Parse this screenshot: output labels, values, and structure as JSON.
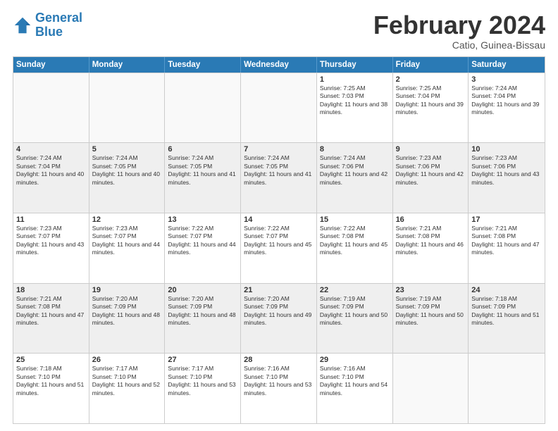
{
  "header": {
    "logo_line1": "General",
    "logo_line2": "Blue",
    "month": "February 2024",
    "location": "Catio, Guinea-Bissau"
  },
  "weekdays": [
    "Sunday",
    "Monday",
    "Tuesday",
    "Wednesday",
    "Thursday",
    "Friday",
    "Saturday"
  ],
  "rows": [
    [
      {
        "day": "",
        "sunrise": "",
        "sunset": "",
        "daylight": "",
        "empty": true
      },
      {
        "day": "",
        "sunrise": "",
        "sunset": "",
        "daylight": "",
        "empty": true
      },
      {
        "day": "",
        "sunrise": "",
        "sunset": "",
        "daylight": "",
        "empty": true
      },
      {
        "day": "",
        "sunrise": "",
        "sunset": "",
        "daylight": "",
        "empty": true
      },
      {
        "day": "1",
        "sunrise": "Sunrise: 7:25 AM",
        "sunset": "Sunset: 7:03 PM",
        "daylight": "Daylight: 11 hours and 38 minutes."
      },
      {
        "day": "2",
        "sunrise": "Sunrise: 7:25 AM",
        "sunset": "Sunset: 7:04 PM",
        "daylight": "Daylight: 11 hours and 39 minutes."
      },
      {
        "day": "3",
        "sunrise": "Sunrise: 7:24 AM",
        "sunset": "Sunset: 7:04 PM",
        "daylight": "Daylight: 11 hours and 39 minutes."
      }
    ],
    [
      {
        "day": "4",
        "sunrise": "Sunrise: 7:24 AM",
        "sunset": "Sunset: 7:04 PM",
        "daylight": "Daylight: 11 hours and 40 minutes."
      },
      {
        "day": "5",
        "sunrise": "Sunrise: 7:24 AM",
        "sunset": "Sunset: 7:05 PM",
        "daylight": "Daylight: 11 hours and 40 minutes."
      },
      {
        "day": "6",
        "sunrise": "Sunrise: 7:24 AM",
        "sunset": "Sunset: 7:05 PM",
        "daylight": "Daylight: 11 hours and 41 minutes."
      },
      {
        "day": "7",
        "sunrise": "Sunrise: 7:24 AM",
        "sunset": "Sunset: 7:05 PM",
        "daylight": "Daylight: 11 hours and 41 minutes."
      },
      {
        "day": "8",
        "sunrise": "Sunrise: 7:24 AM",
        "sunset": "Sunset: 7:06 PM",
        "daylight": "Daylight: 11 hours and 42 minutes."
      },
      {
        "day": "9",
        "sunrise": "Sunrise: 7:23 AM",
        "sunset": "Sunset: 7:06 PM",
        "daylight": "Daylight: 11 hours and 42 minutes."
      },
      {
        "day": "10",
        "sunrise": "Sunrise: 7:23 AM",
        "sunset": "Sunset: 7:06 PM",
        "daylight": "Daylight: 11 hours and 43 minutes."
      }
    ],
    [
      {
        "day": "11",
        "sunrise": "Sunrise: 7:23 AM",
        "sunset": "Sunset: 7:07 PM",
        "daylight": "Daylight: 11 hours and 43 minutes."
      },
      {
        "day": "12",
        "sunrise": "Sunrise: 7:23 AM",
        "sunset": "Sunset: 7:07 PM",
        "daylight": "Daylight: 11 hours and 44 minutes."
      },
      {
        "day": "13",
        "sunrise": "Sunrise: 7:22 AM",
        "sunset": "Sunset: 7:07 PM",
        "daylight": "Daylight: 11 hours and 44 minutes."
      },
      {
        "day": "14",
        "sunrise": "Sunrise: 7:22 AM",
        "sunset": "Sunset: 7:07 PM",
        "daylight": "Daylight: 11 hours and 45 minutes."
      },
      {
        "day": "15",
        "sunrise": "Sunrise: 7:22 AM",
        "sunset": "Sunset: 7:08 PM",
        "daylight": "Daylight: 11 hours and 45 minutes."
      },
      {
        "day": "16",
        "sunrise": "Sunrise: 7:21 AM",
        "sunset": "Sunset: 7:08 PM",
        "daylight": "Daylight: 11 hours and 46 minutes."
      },
      {
        "day": "17",
        "sunrise": "Sunrise: 7:21 AM",
        "sunset": "Sunset: 7:08 PM",
        "daylight": "Daylight: 11 hours and 47 minutes."
      }
    ],
    [
      {
        "day": "18",
        "sunrise": "Sunrise: 7:21 AM",
        "sunset": "Sunset: 7:08 PM",
        "daylight": "Daylight: 11 hours and 47 minutes."
      },
      {
        "day": "19",
        "sunrise": "Sunrise: 7:20 AM",
        "sunset": "Sunset: 7:09 PM",
        "daylight": "Daylight: 11 hours and 48 minutes."
      },
      {
        "day": "20",
        "sunrise": "Sunrise: 7:20 AM",
        "sunset": "Sunset: 7:09 PM",
        "daylight": "Daylight: 11 hours and 48 minutes."
      },
      {
        "day": "21",
        "sunrise": "Sunrise: 7:20 AM",
        "sunset": "Sunset: 7:09 PM",
        "daylight": "Daylight: 11 hours and 49 minutes."
      },
      {
        "day": "22",
        "sunrise": "Sunrise: 7:19 AM",
        "sunset": "Sunset: 7:09 PM",
        "daylight": "Daylight: 11 hours and 50 minutes."
      },
      {
        "day": "23",
        "sunrise": "Sunrise: 7:19 AM",
        "sunset": "Sunset: 7:09 PM",
        "daylight": "Daylight: 11 hours and 50 minutes."
      },
      {
        "day": "24",
        "sunrise": "Sunrise: 7:18 AM",
        "sunset": "Sunset: 7:09 PM",
        "daylight": "Daylight: 11 hours and 51 minutes."
      }
    ],
    [
      {
        "day": "25",
        "sunrise": "Sunrise: 7:18 AM",
        "sunset": "Sunset: 7:10 PM",
        "daylight": "Daylight: 11 hours and 51 minutes."
      },
      {
        "day": "26",
        "sunrise": "Sunrise: 7:17 AM",
        "sunset": "Sunset: 7:10 PM",
        "daylight": "Daylight: 11 hours and 52 minutes."
      },
      {
        "day": "27",
        "sunrise": "Sunrise: 7:17 AM",
        "sunset": "Sunset: 7:10 PM",
        "daylight": "Daylight: 11 hours and 53 minutes."
      },
      {
        "day": "28",
        "sunrise": "Sunrise: 7:16 AM",
        "sunset": "Sunset: 7:10 PM",
        "daylight": "Daylight: 11 hours and 53 minutes."
      },
      {
        "day": "29",
        "sunrise": "Sunrise: 7:16 AM",
        "sunset": "Sunset: 7:10 PM",
        "daylight": "Daylight: 11 hours and 54 minutes."
      },
      {
        "day": "",
        "sunrise": "",
        "sunset": "",
        "daylight": "",
        "empty": true
      },
      {
        "day": "",
        "sunrise": "",
        "sunset": "",
        "daylight": "",
        "empty": true
      }
    ]
  ]
}
